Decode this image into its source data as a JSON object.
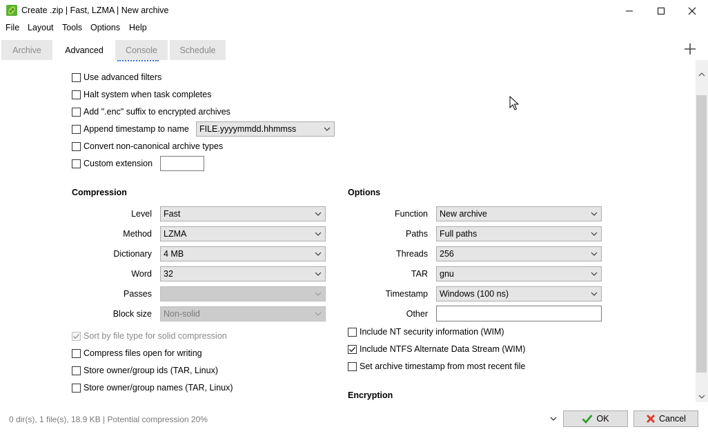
{
  "window": {
    "title": "Create .zip | Fast, LZMA | New archive"
  },
  "menu": [
    "File",
    "Layout",
    "Tools",
    "Options",
    "Help"
  ],
  "tabs": [
    {
      "label": "Archive",
      "active": false
    },
    {
      "label": "Advanced",
      "active": true
    },
    {
      "label": "Console",
      "active": false
    },
    {
      "label": "Schedule",
      "active": false
    }
  ],
  "advanced_options": {
    "use_advanced_filters": {
      "label": "Use advanced filters",
      "checked": false
    },
    "halt_system": {
      "label": "Halt system when task completes",
      "checked": false
    },
    "add_enc_suffix": {
      "label": "Add \".enc\" suffix to encrypted archives",
      "checked": false
    },
    "append_timestamp": {
      "label": "Append timestamp to name",
      "checked": false,
      "format": "FILE.yyyymmdd.hhmmss"
    },
    "convert_noncanonical": {
      "label": "Convert non-canonical archive types",
      "checked": false
    },
    "custom_extension": {
      "label": "Custom extension",
      "checked": false,
      "value": ""
    }
  },
  "compression": {
    "heading": "Compression",
    "level": {
      "label": "Level",
      "value": "Fast"
    },
    "method": {
      "label": "Method",
      "value": "LZMA"
    },
    "dictionary": {
      "label": "Dictionary",
      "value": "4 MB"
    },
    "word": {
      "label": "Word",
      "value": "32"
    },
    "passes": {
      "label": "Passes",
      "value": ""
    },
    "block_size": {
      "label": "Block size",
      "value": "Non-solid"
    },
    "sort_by_type": {
      "label": "Sort by file type for solid compression",
      "checked": true,
      "disabled": true
    },
    "compress_open": {
      "label": "Compress files open for writing",
      "checked": false
    },
    "store_owner_ids": {
      "label": "Store owner/group ids (TAR, Linux)",
      "checked": false
    },
    "store_owner_names": {
      "label": "Store owner/group names (TAR, Linux)",
      "checked": false
    }
  },
  "options": {
    "heading": "Options",
    "function": {
      "label": "Function",
      "value": "New archive"
    },
    "paths": {
      "label": "Paths",
      "value": "Full paths"
    },
    "threads": {
      "label": "Threads",
      "value": "256"
    },
    "tar": {
      "label": "TAR",
      "value": "gnu"
    },
    "timestamp": {
      "label": "Timestamp",
      "value": "Windows (100 ns)"
    },
    "other": {
      "label": "Other",
      "value": ""
    },
    "nt_security": {
      "label": "Include NT security information (WIM)",
      "checked": false
    },
    "ntfs_ads": {
      "label": "Include NTFS Alternate Data Stream (WIM)",
      "checked": true
    },
    "set_archive_timestamp": {
      "label": "Set archive timestamp from most recent file",
      "checked": false
    }
  },
  "encryption": {
    "heading": "Encryption"
  },
  "status": {
    "text": "0 dir(s), 1 file(s), 18.9 KB | Potential compression 20%",
    "ok_label": "OK",
    "cancel_label": "Cancel"
  },
  "colors": {
    "accent_green": "#2e9e2e",
    "cancel_red": "#d83a2a",
    "app_icon_green": "#5bb033"
  }
}
